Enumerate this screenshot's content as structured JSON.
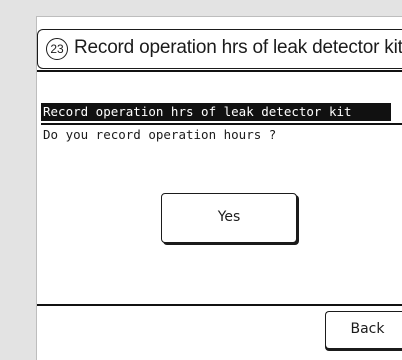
{
  "header": {
    "step_number": "23",
    "title": "Record operation hrs of leak detector kit"
  },
  "screen": {
    "heading": "Record operation hrs of leak detector kit",
    "question": "Do you record operation hours ?"
  },
  "buttons": {
    "yes_label": "Yes",
    "back_label": "Back"
  },
  "colors": {
    "background": "#e3e3e3",
    "panel": "#ffffff",
    "ink": "#1b1b1b"
  }
}
